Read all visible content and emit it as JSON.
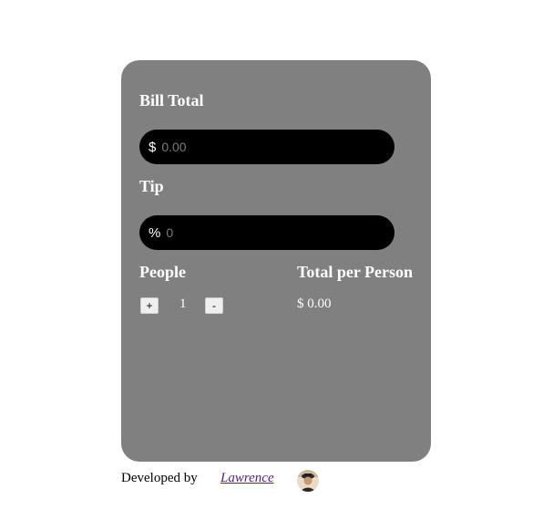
{
  "bill": {
    "label": "Bill Total",
    "prefix": "$",
    "placeholder": "0.00",
    "value": ""
  },
  "tip": {
    "label": "Tip",
    "prefix": "%",
    "placeholder": "0",
    "value": ""
  },
  "people": {
    "label": "People",
    "increment_label": "+",
    "decrement_label": "-",
    "count": "1"
  },
  "total": {
    "label": "Total per Person",
    "value": "$ 0.00"
  },
  "footer": {
    "text": "Developed by",
    "link_text": "Lawrence",
    "avatar_icon": "user-avatar-photo"
  },
  "colors": {
    "card_background": "#808080",
    "input_background": "#000000",
    "link": "#551a8b"
  }
}
